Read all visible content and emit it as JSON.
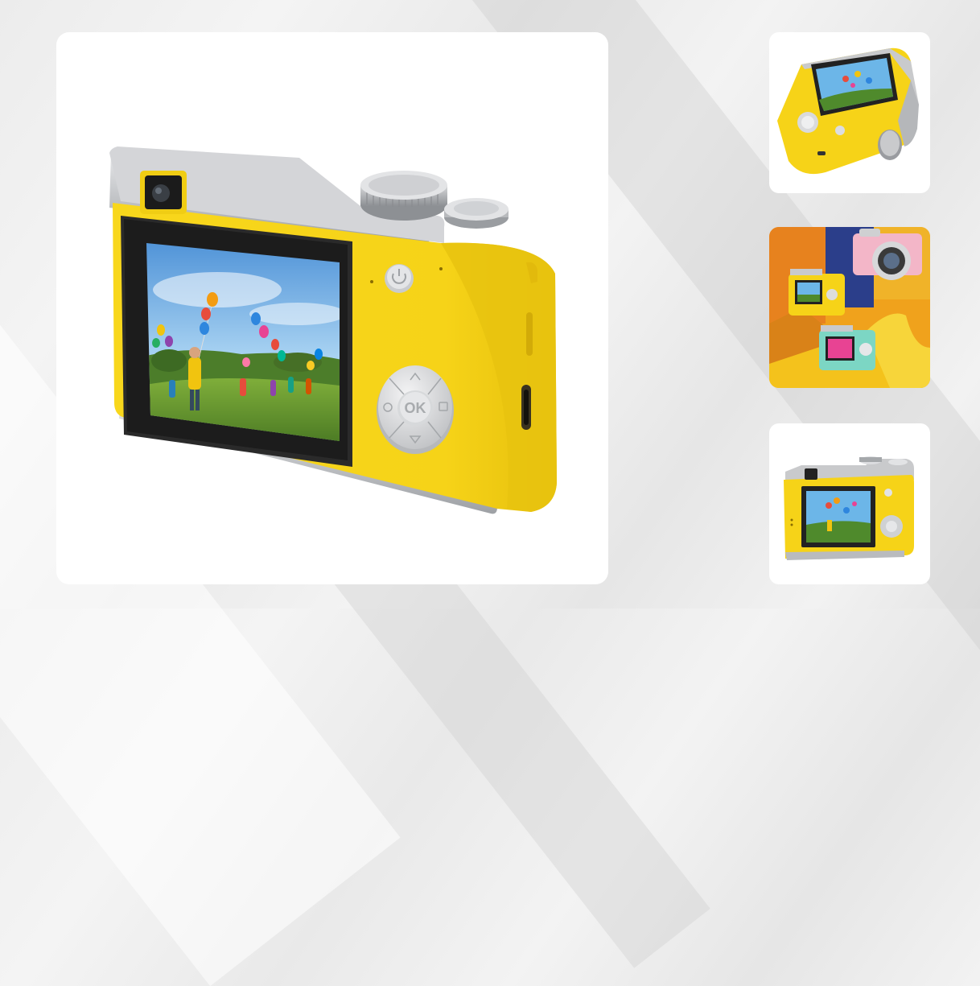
{
  "gallery": {
    "main_image": {
      "subject": "yellow-camera-back-view",
      "button_labels": {
        "ok": "OK"
      }
    },
    "thumbnails": [
      {
        "subject": "yellow-camera-angled-top-view"
      },
      {
        "subject": "pink-yellow-teal-cameras-scene"
      },
      {
        "subject": "yellow-camera-front-back-view"
      }
    ]
  },
  "colors": {
    "camera_yellow": "#f6d318",
    "camera_silver": "#c9cacc",
    "page_background": "#ececec",
    "card_background": "#ffffff"
  }
}
